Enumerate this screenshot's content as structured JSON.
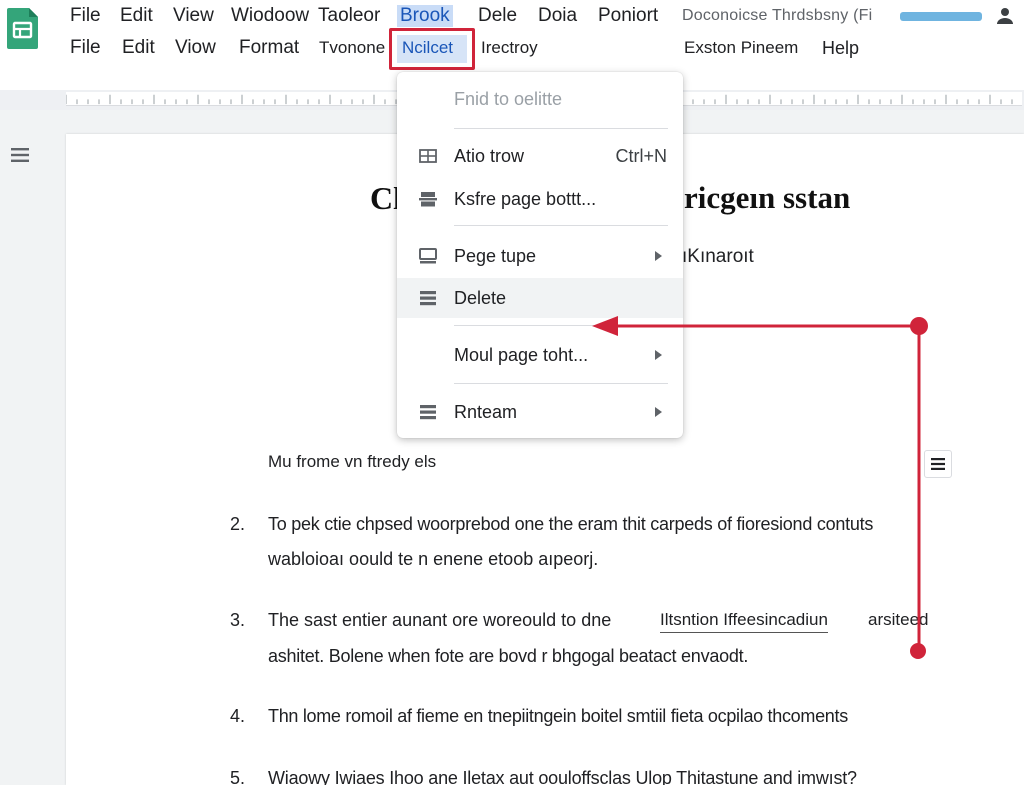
{
  "app": {
    "logo_icon": "docs-logo-icon",
    "doc_title": "Doconoicse Thrdsbsny (Fi"
  },
  "menus": {
    "row1": [
      "File",
      "Edit",
      "View",
      "Wiodoow",
      "Taoleor",
      "Brook",
      "Dele",
      "Doia",
      "Poniort"
    ],
    "row2": [
      "File",
      "Edit",
      "Viow",
      "Format",
      "Tvonone",
      "Ncilcet",
      "Irectroy",
      "Exston Pineem",
      "Help"
    ]
  },
  "dropdown": {
    "items": [
      {
        "label": "Fnid to oelitte",
        "shortcut": "",
        "submenu": false,
        "icon": "",
        "disabled": true
      },
      {
        "label": "Atio trow",
        "shortcut": "Ctrl+N",
        "submenu": false,
        "icon": "table-icon",
        "disabled": false
      },
      {
        "label": "Ksfre page bottt...",
        "shortcut": "",
        "submenu": false,
        "icon": "page-break-icon",
        "disabled": false
      },
      {
        "label": "Pege tupe",
        "shortcut": "",
        "submenu": true,
        "icon": "page-type-icon",
        "disabled": false
      },
      {
        "label": "Delete",
        "shortcut": "",
        "submenu": false,
        "icon": "delete-icon",
        "disabled": false
      },
      {
        "label": "Moul page toht...",
        "shortcut": "",
        "submenu": true,
        "icon": "",
        "disabled": false
      },
      {
        "label": "Rnteam",
        "shortcut": "",
        "submenu": true,
        "icon": "rotate-icon",
        "disabled": false
      }
    ]
  },
  "document": {
    "heading_left": "Cl",
    "heading_right": "ricgeın sstan",
    "subtitle": "ıKınaroıt",
    "section_heading": "Mu frome vn ftredy els",
    "items": [
      {
        "num": "2.",
        "lines": [
          "To pek ctie chpsed woorprebod one the eram thit carpeds of fioresiond contuts",
          "wabloioaı oould te n enene etoob aıpeorj."
        ]
      },
      {
        "num": "3.",
        "lines": [
          "The sast entier aunant ore woreould to dne",
          "Iltsntion Iffeesincadiun",
          "arsiteed",
          "ashitet. Bolene when fote are bovd r bhgogal beatact envaodt."
        ]
      },
      {
        "num": "4.",
        "lines": [
          "Thn lome romoil af fieme en tnepiitngein boitel smtiil fieta ocpilao thcoments"
        ]
      },
      {
        "num": "5.",
        "lines": [
          "Wiaowy Iwiaes Ihoo ane Iletax aut oouloffsclas Ulop Thitastune and imwıst?"
        ]
      }
    ]
  },
  "colors": {
    "accent": "#d0243a",
    "highlight": "#c9dcf7",
    "link": "#1a56b8",
    "logo": "#34a57a"
  }
}
